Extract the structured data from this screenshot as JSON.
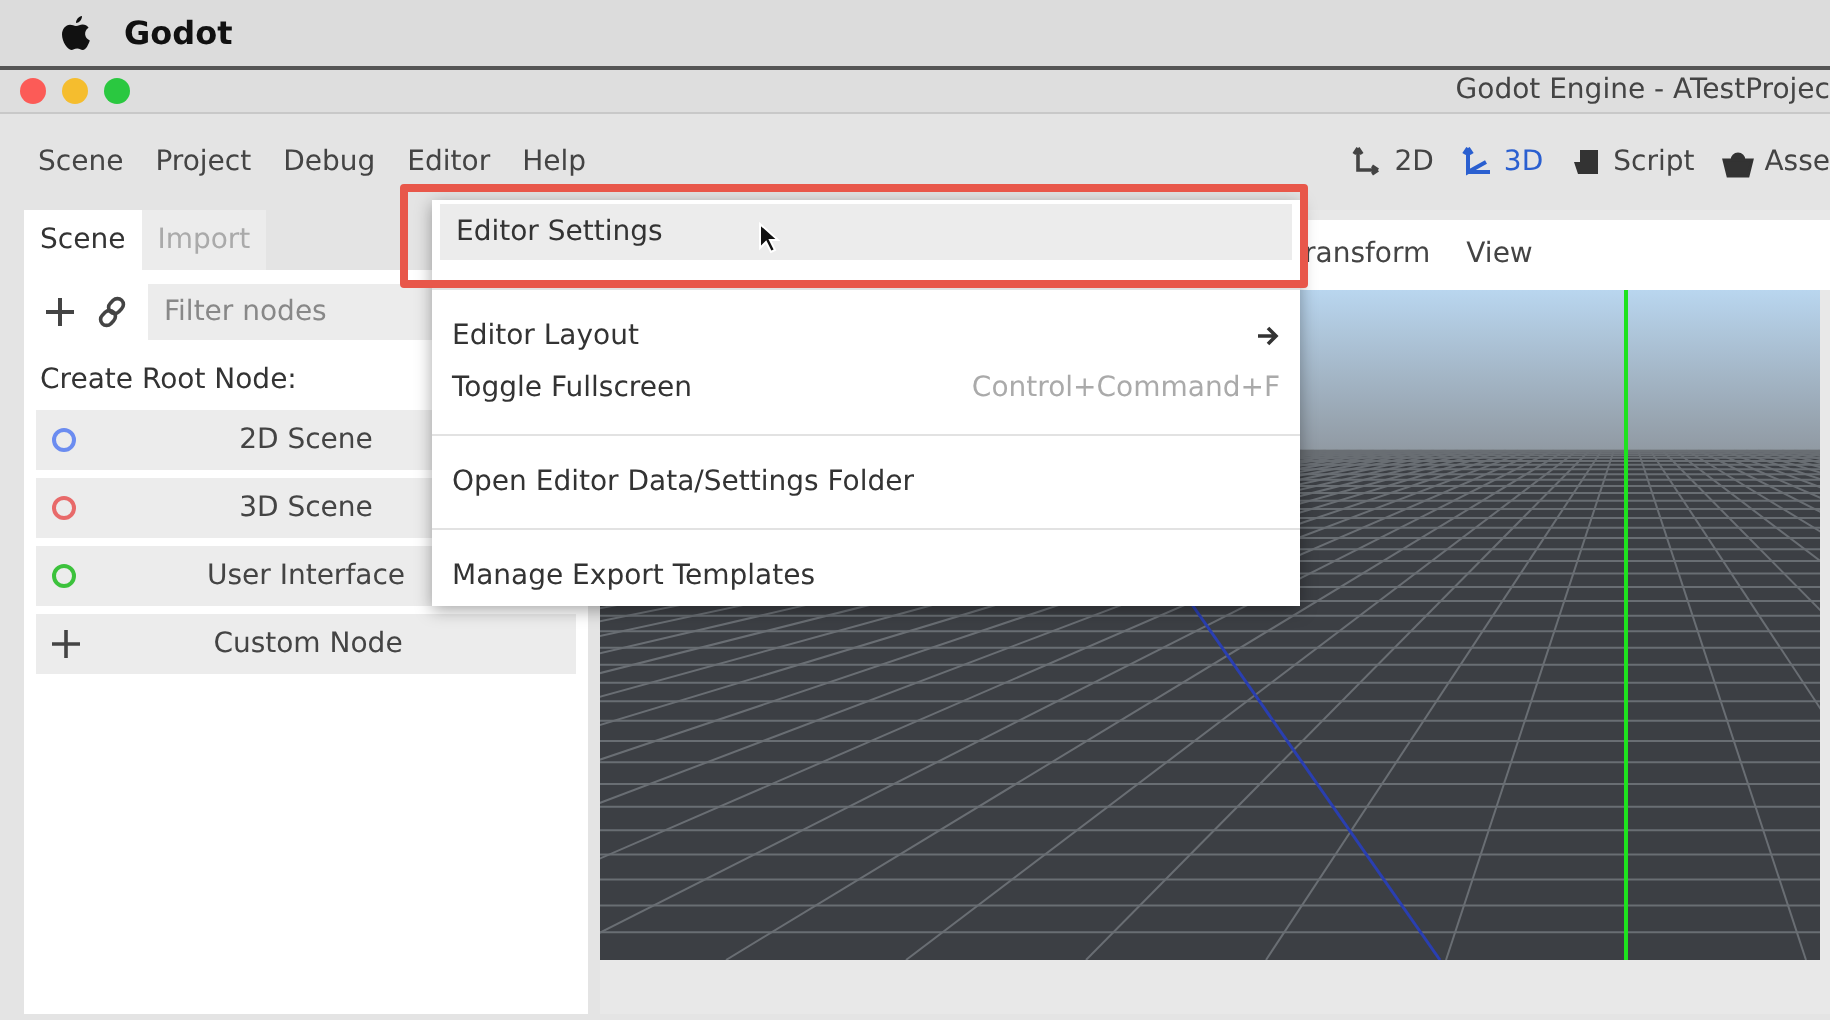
{
  "mac_menu_bar": {
    "app_name": "Godot"
  },
  "window": {
    "title": "Godot Engine - ATestProjec"
  },
  "menu_bar": {
    "items": [
      {
        "label": "Scene"
      },
      {
        "label": "Project"
      },
      {
        "label": "Debug"
      },
      {
        "label": "Editor"
      },
      {
        "label": "Help"
      }
    ],
    "workspaces": [
      {
        "label": "2D",
        "kind": "planar",
        "selected": false
      },
      {
        "label": "3D",
        "kind": "spatial",
        "selected": true
      },
      {
        "label": "Script",
        "kind": "script",
        "selected": false
      },
      {
        "label": "Asse",
        "kind": "assets",
        "selected": false
      }
    ]
  },
  "dock": {
    "tabs": [
      {
        "label": "Scene",
        "selected": true
      },
      {
        "label": "Import",
        "selected": false
      }
    ],
    "filter": {
      "placeholder": "Filter nodes"
    },
    "heading": "Create Root Node:",
    "root_nodes": [
      {
        "label": "2D Scene",
        "kind": "circle",
        "color": "#6b8cf0"
      },
      {
        "label": "3D Scene",
        "kind": "circle",
        "color": "#e86a6a"
      },
      {
        "label": "User Interface",
        "kind": "circle",
        "color": "#3cc23c"
      },
      {
        "label": "Custom Node",
        "kind": "plus"
      }
    ]
  },
  "viewport": {
    "menu": [
      "ransform",
      "View"
    ]
  },
  "editor_menu": {
    "items": [
      {
        "kind": "item",
        "label": "Editor Settings",
        "selected": true,
        "highlighted": true
      },
      {
        "kind": "separator"
      },
      {
        "kind": "submenu",
        "label": "Editor Layout",
        "selected": false,
        "highlighted": false
      },
      {
        "kind": "item",
        "label": "Toggle Fullscreen",
        "shortcut": "Control+Command+F",
        "selected": false,
        "highlighted": false
      },
      {
        "kind": "separator"
      },
      {
        "kind": "item",
        "label": "Open Editor Data/Settings Folder",
        "selected": false,
        "highlighted": false
      },
      {
        "kind": "separator"
      },
      {
        "kind": "item",
        "label": "Manage Export Templates",
        "selected": false,
        "highlighted": false
      }
    ]
  }
}
